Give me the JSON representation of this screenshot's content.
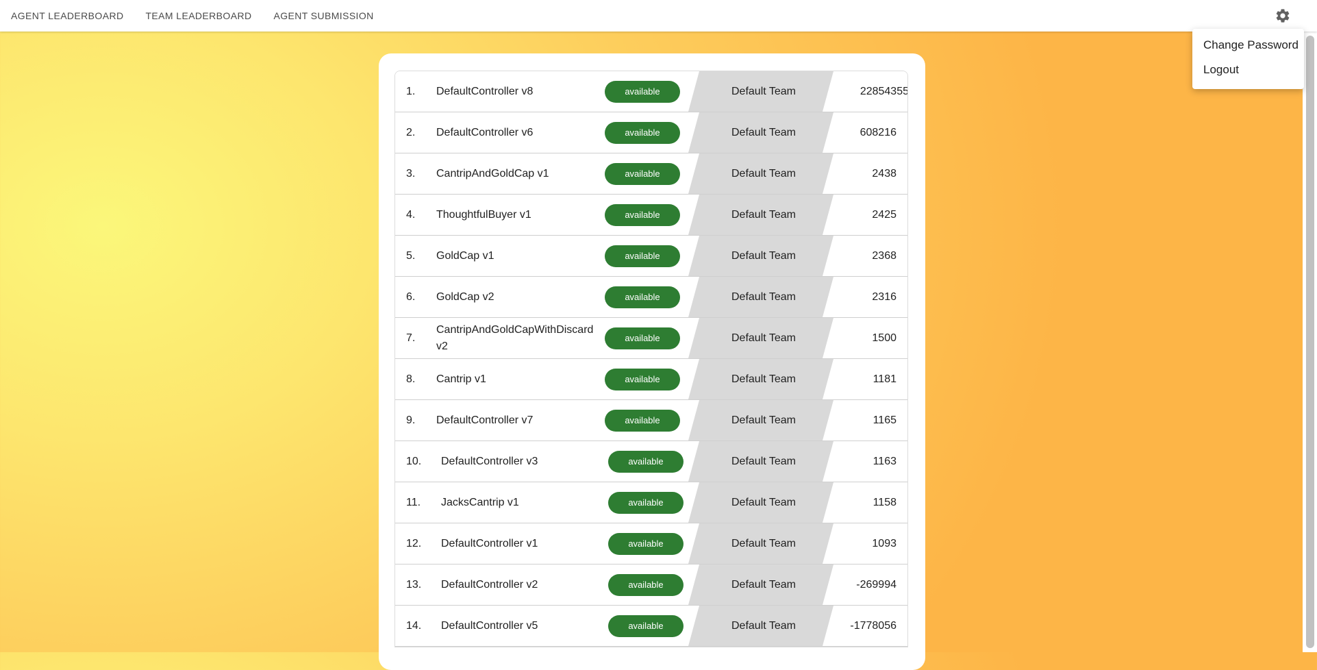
{
  "nav": {
    "links": [
      "AGENT LEADERBOARD",
      "TEAM LEADERBOARD",
      "AGENT SUBMISSION"
    ]
  },
  "icons": {
    "settings": "gear-icon"
  },
  "menu": {
    "items": [
      "Change Password",
      "Logout"
    ]
  },
  "colors": {
    "badge": "#2e7d32",
    "team_cell": "#d9d9d9",
    "bg_light": "#fbf77a",
    "bg_dark": "#fdb547"
  },
  "leaderboard": {
    "rows": [
      {
        "rank": "1.",
        "name": "DefaultController v8",
        "status": "available",
        "team": "Default Team",
        "score": "22854355"
      },
      {
        "rank": "2.",
        "name": "DefaultController v6",
        "status": "available",
        "team": "Default Team",
        "score": "608216"
      },
      {
        "rank": "3.",
        "name": "CantripAndGoldCap v1",
        "status": "available",
        "team": "Default Team",
        "score": "2438"
      },
      {
        "rank": "4.",
        "name": "ThoughtfulBuyer v1",
        "status": "available",
        "team": "Default Team",
        "score": "2425"
      },
      {
        "rank": "5.",
        "name": "GoldCap v1",
        "status": "available",
        "team": "Default Team",
        "score": "2368"
      },
      {
        "rank": "6.",
        "name": "GoldCap v2",
        "status": "available",
        "team": "Default Team",
        "score": "2316"
      },
      {
        "rank": "7.",
        "name": "CantripAndGoldCapWithDiscard v2",
        "status": "available",
        "team": "Default Team",
        "score": "1500"
      },
      {
        "rank": "8.",
        "name": "Cantrip v1",
        "status": "available",
        "team": "Default Team",
        "score": "1181"
      },
      {
        "rank": "9.",
        "name": "DefaultController v7",
        "status": "available",
        "team": "Default Team",
        "score": "1165"
      },
      {
        "rank": "10.",
        "name": "DefaultController v3",
        "status": "available",
        "team": "Default Team",
        "score": "1163"
      },
      {
        "rank": "11.",
        "name": "JacksCantrip v1",
        "status": "available",
        "team": "Default Team",
        "score": "1158"
      },
      {
        "rank": "12.",
        "name": "DefaultController v1",
        "status": "available",
        "team": "Default Team",
        "score": "1093"
      },
      {
        "rank": "13.",
        "name": "DefaultController v2",
        "status": "available",
        "team": "Default Team",
        "score": "-269994"
      },
      {
        "rank": "14.",
        "name": "DefaultController v5",
        "status": "available",
        "team": "Default Team",
        "score": "-1778056"
      }
    ]
  }
}
